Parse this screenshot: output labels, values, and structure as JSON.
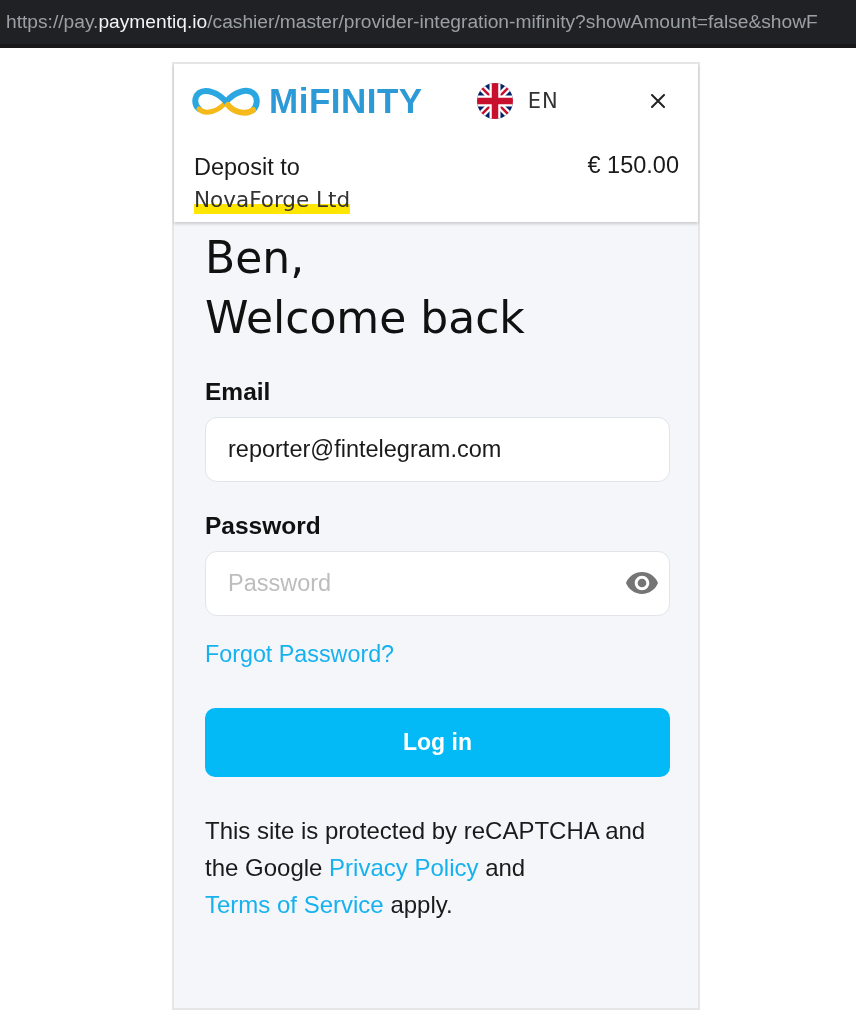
{
  "address_bar": {
    "url_prefix": "https://pay.",
    "url_domain": "paymentiq.io",
    "url_path": "/cashier/master/provider-integration-mifinity?showAmount=false&showF"
  },
  "header": {
    "logo": {
      "text": "MiFINITY"
    },
    "language": {
      "code": "EN"
    },
    "deposit_label": "Deposit to",
    "amount": "€ 150.00",
    "merchant": {
      "text": "NovaForge Ltd",
      "highlighted": true
    }
  },
  "greeting": [
    "Ben,",
    "Welcome back"
  ],
  "form": {
    "fields": [
      {
        "kind": "email",
        "label": "Email",
        "value": "reporter@fintelegram.com"
      },
      {
        "kind": "password",
        "label": "Password",
        "placeholder": "Password"
      }
    ],
    "forgot_link": "Forgot Password?",
    "login_button": "Log in"
  },
  "notice": [
    {
      "kind": "text",
      "text": "This site is protected by reCAPTCHA and the Google "
    },
    {
      "kind": "link",
      "text": "Privacy Policy"
    },
    {
      "kind": "text",
      "text": " and "
    },
    {
      "kind": "link",
      "text": "Terms of Service"
    },
    {
      "kind": "text",
      "text": " apply."
    }
  ]
}
